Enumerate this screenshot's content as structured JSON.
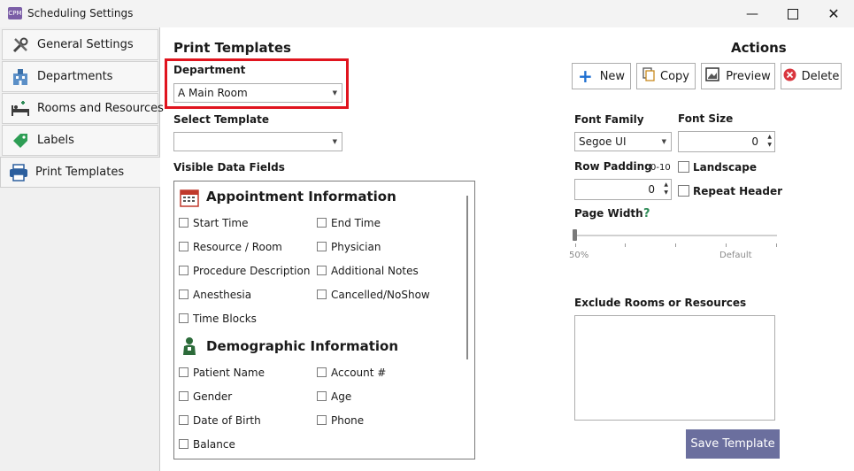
{
  "window": {
    "title": "Scheduling Settings",
    "app_icon_text": "CPM"
  },
  "sidebar": {
    "items": [
      {
        "label": "General Settings",
        "icon": "tools-icon"
      },
      {
        "label": "Departments",
        "icon": "building-icon"
      },
      {
        "label": "Rooms and Resources",
        "icon": "bed-icon"
      },
      {
        "label": "Labels",
        "icon": "tag-icon"
      },
      {
        "label": "Print Templates",
        "icon": "printer-icon"
      }
    ],
    "active": "Print Templates"
  },
  "main": {
    "title": "Print Templates",
    "department": {
      "label": "Department",
      "value": "A Main Room"
    },
    "select_template": {
      "label": "Select Template",
      "value": ""
    },
    "visible_fields": {
      "label": "Visible Data Fields",
      "groups": [
        {
          "title": "Appointment Information",
          "icon": "calendar-icon",
          "fields": [
            "Start Time",
            "End Time",
            "Resource / Room",
            "Physician",
            "Procedure Description",
            "Additional Notes",
            "Anesthesia",
            "Cancelled/NoShow",
            "Time Blocks"
          ]
        },
        {
          "title": "Demographic Information",
          "icon": "person-icon",
          "fields": [
            "Patient Name",
            "Account #",
            "Gender",
            "Age",
            "Date of Birth",
            "Phone",
            "Balance"
          ]
        }
      ]
    }
  },
  "actions": {
    "title": "Actions",
    "new_label": "New",
    "copy_label": "Copy",
    "preview_label": "Preview",
    "delete_label": "Delete",
    "font_family_label": "Font Family",
    "font_family_value": "Segoe UI",
    "font_size_label": "Font Size",
    "font_size_value": "0",
    "row_padding_label": "Row Padding",
    "row_padding_hint": "0-10",
    "row_padding_value": "0",
    "landscape_label": "Landscape",
    "repeat_header_label": "Repeat Header",
    "page_width_label": "Page Width",
    "page_width_help": "?",
    "page_width_min_label": "50%",
    "page_width_default_label": "Default",
    "page_width_value_fraction": 0,
    "exclude_label": "Exclude Rooms or Resources",
    "save_label": "Save Template"
  },
  "colors": {
    "highlight_red": "#e0141e",
    "save_button_bg": "#6b6f9e",
    "help_green": "#2e8b57",
    "delete_red": "#d9363e",
    "new_blue": "#1f6fd1"
  }
}
